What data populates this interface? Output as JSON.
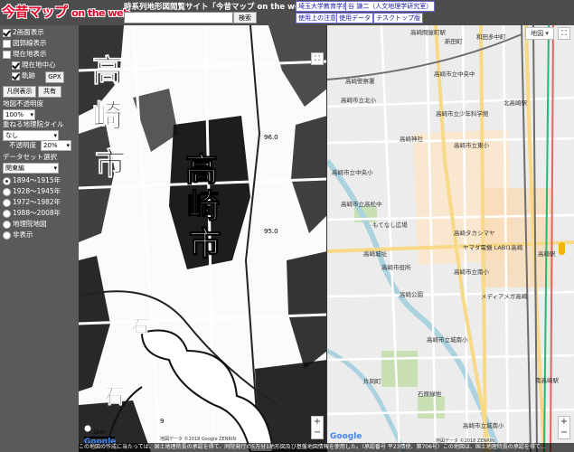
{
  "header": {
    "logo": "今昔マップ",
    "logo_sub": "on the web",
    "site_title": "時系列地形図閲覧サイト「今昔マップ on the web」",
    "search_placeholder": "",
    "search_button": "検索",
    "links": [
      "埼玉大学教育学部",
      "谷 謙二（人文地理学研究室）",
      "使用上の注意",
      "使用データ",
      "テスクトップ版"
    ]
  },
  "sidebar": {
    "checkboxes": [
      {
        "label": "2画面表示",
        "checked": true
      },
      {
        "label": "図郭線表示",
        "checked": false
      },
      {
        "label": "現在地表示",
        "checked": false
      }
    ],
    "sub_checkboxes": [
      {
        "label": "現在地中心",
        "checked": true
      },
      {
        "label": "軌跡",
        "checked": true
      }
    ],
    "gpx_button": "GPX",
    "legend_button": "凡例表示",
    "share_button": "共有",
    "opacity_label": "地図不透明度",
    "opacity_value": "100%",
    "overlay_label": "重ねる地理院タイル",
    "overlay_value": "なし",
    "overlay_opacity_label": "不透明度",
    "overlay_opacity_value": "20%",
    "dataset_label": "データセット選択",
    "dataset_value": "関東編",
    "periods": [
      {
        "label": "1894～1915年",
        "selected": true
      },
      {
        "label": "1928～1945年",
        "selected": false
      },
      {
        "label": "1972～1982年",
        "selected": false
      },
      {
        "label": "1988～2008年",
        "selected": false
      },
      {
        "label": "地理院地図",
        "selected": false
      },
      {
        "label": "非表示",
        "selected": false
      }
    ]
  },
  "old_map": {
    "kanji_labels": [
      "高",
      "崎",
      "市",
      "高",
      "崎",
      "市",
      "石",
      "石"
    ],
    "number_labels": [
      "96.0",
      "95.0",
      "9"
    ],
    "scale_label": "1km",
    "attribution": "地図データ ©2018 Google ZENRIN"
  },
  "new_map": {
    "map_type_label": "地図",
    "labels": [
      {
        "text": "高崎問屋町駅"
      },
      {
        "text": "新田町"
      },
      {
        "text": "高崎警察署"
      },
      {
        "text": "高崎市立北小"
      },
      {
        "text": "北高崎駅"
      },
      {
        "text": "高崎市立少年科学館"
      },
      {
        "text": "高崎神社"
      },
      {
        "text": "高崎市立東小"
      },
      {
        "text": "高崎市立中央小"
      },
      {
        "text": "高崎市立高松中"
      },
      {
        "text": "もてなし広場"
      },
      {
        "text": "高崎タカシマヤ"
      },
      {
        "text": "ヤマダ電機 LABI1高崎"
      },
      {
        "text": "高崎城址"
      },
      {
        "text": "高崎市役所"
      },
      {
        "text": "高崎市立南小"
      },
      {
        "text": "高崎公園"
      },
      {
        "text": "メディアメガ高崎"
      },
      {
        "text": "高崎市立城南小"
      },
      {
        "text": "石原緑地"
      },
      {
        "text": "片岡町"
      },
      {
        "text": "高崎市立城南小"
      },
      {
        "text": "高崎駅"
      },
      {
        "text": "南高崎駅"
      },
      {
        "text": "和田多中町"
      },
      {
        "text": "高崎市立中央中"
      }
    ],
    "attribution": "地図データ ©2018 ZENRIN",
    "footer_note": "この地図の作成に当たっては、国土地理院長の承認を得て、同院発行の5万分1地形図及び基盤地図情報を使用した。（承認番号 平23情使、第706号）この地図は、国土地理院長の承認を得て…"
  },
  "colors": {
    "header_bg": "#4d4d4d",
    "sidebar_bg": "#5a5a5a",
    "logo_red": "#e8002a",
    "link_blue": "#1a1aa6",
    "road_yellow": "#f7d987",
    "park_green": "#c8e0b4",
    "water_blue": "#aad3df",
    "rail_color": "#6e6e6e"
  }
}
